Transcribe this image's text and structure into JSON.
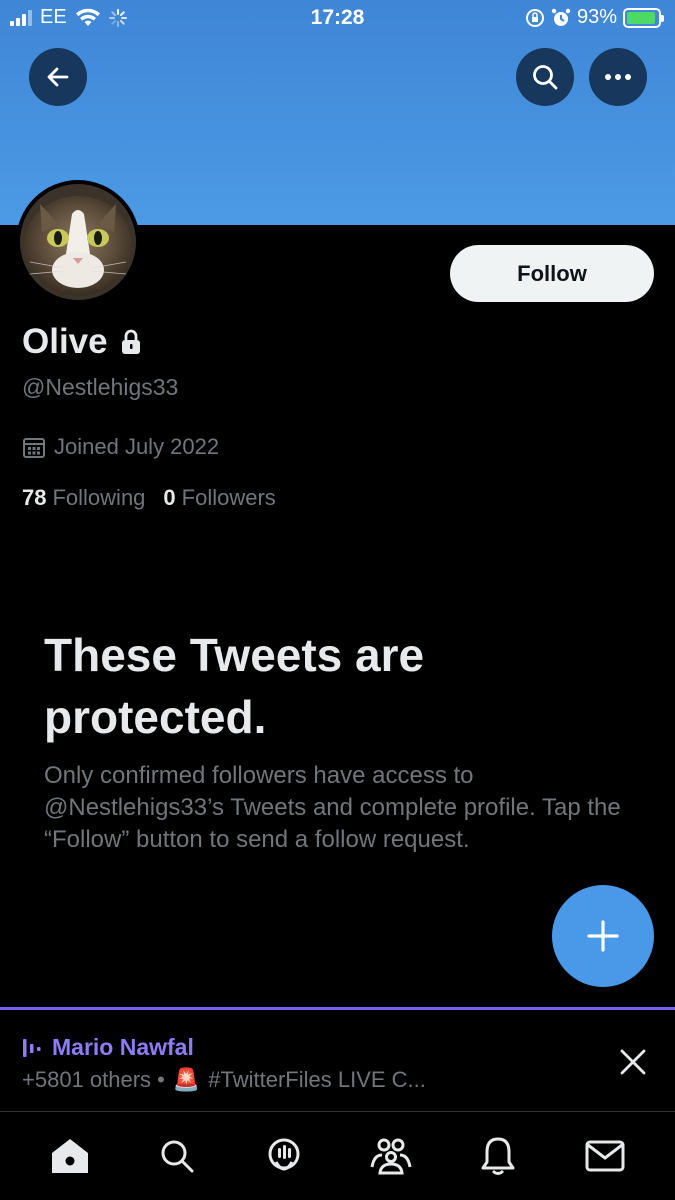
{
  "status_bar": {
    "carrier": "EE",
    "time": "17:28",
    "battery": "93%",
    "battery_level": 0.93
  },
  "header": {
    "back_icon": "arrow-left-icon",
    "search_icon": "search-icon",
    "more_icon": "more-horizontal-icon",
    "banner_color": "#4c9ae6"
  },
  "profile": {
    "name": "Olive",
    "lock_icon": "lock-icon",
    "handle": "@Nestlehigs33",
    "joined": "Joined July 2022",
    "following_count": "78",
    "following_label": "Following",
    "followers_count": "0",
    "followers_label": "Followers",
    "follow_button": "Follow"
  },
  "protected": {
    "title": "These Tweets are protected.",
    "body": "Only confirmed followers have access to @Nestlehigs33’s Tweets and complete profile. Tap the “Follow” button to send a follow request."
  },
  "fab": {
    "icon": "plus-icon",
    "color": "#4a99e9"
  },
  "space": {
    "host": "Mario Nawfal",
    "others": "+5801 others •",
    "siren_emoji": "🚨",
    "title": "#TwitterFiles LIVE C...",
    "accent": "#7b61f0"
  },
  "tabs": [
    "home-icon",
    "search-icon",
    "spaces-icon",
    "communities-icon",
    "notifications-icon",
    "messages-icon"
  ]
}
